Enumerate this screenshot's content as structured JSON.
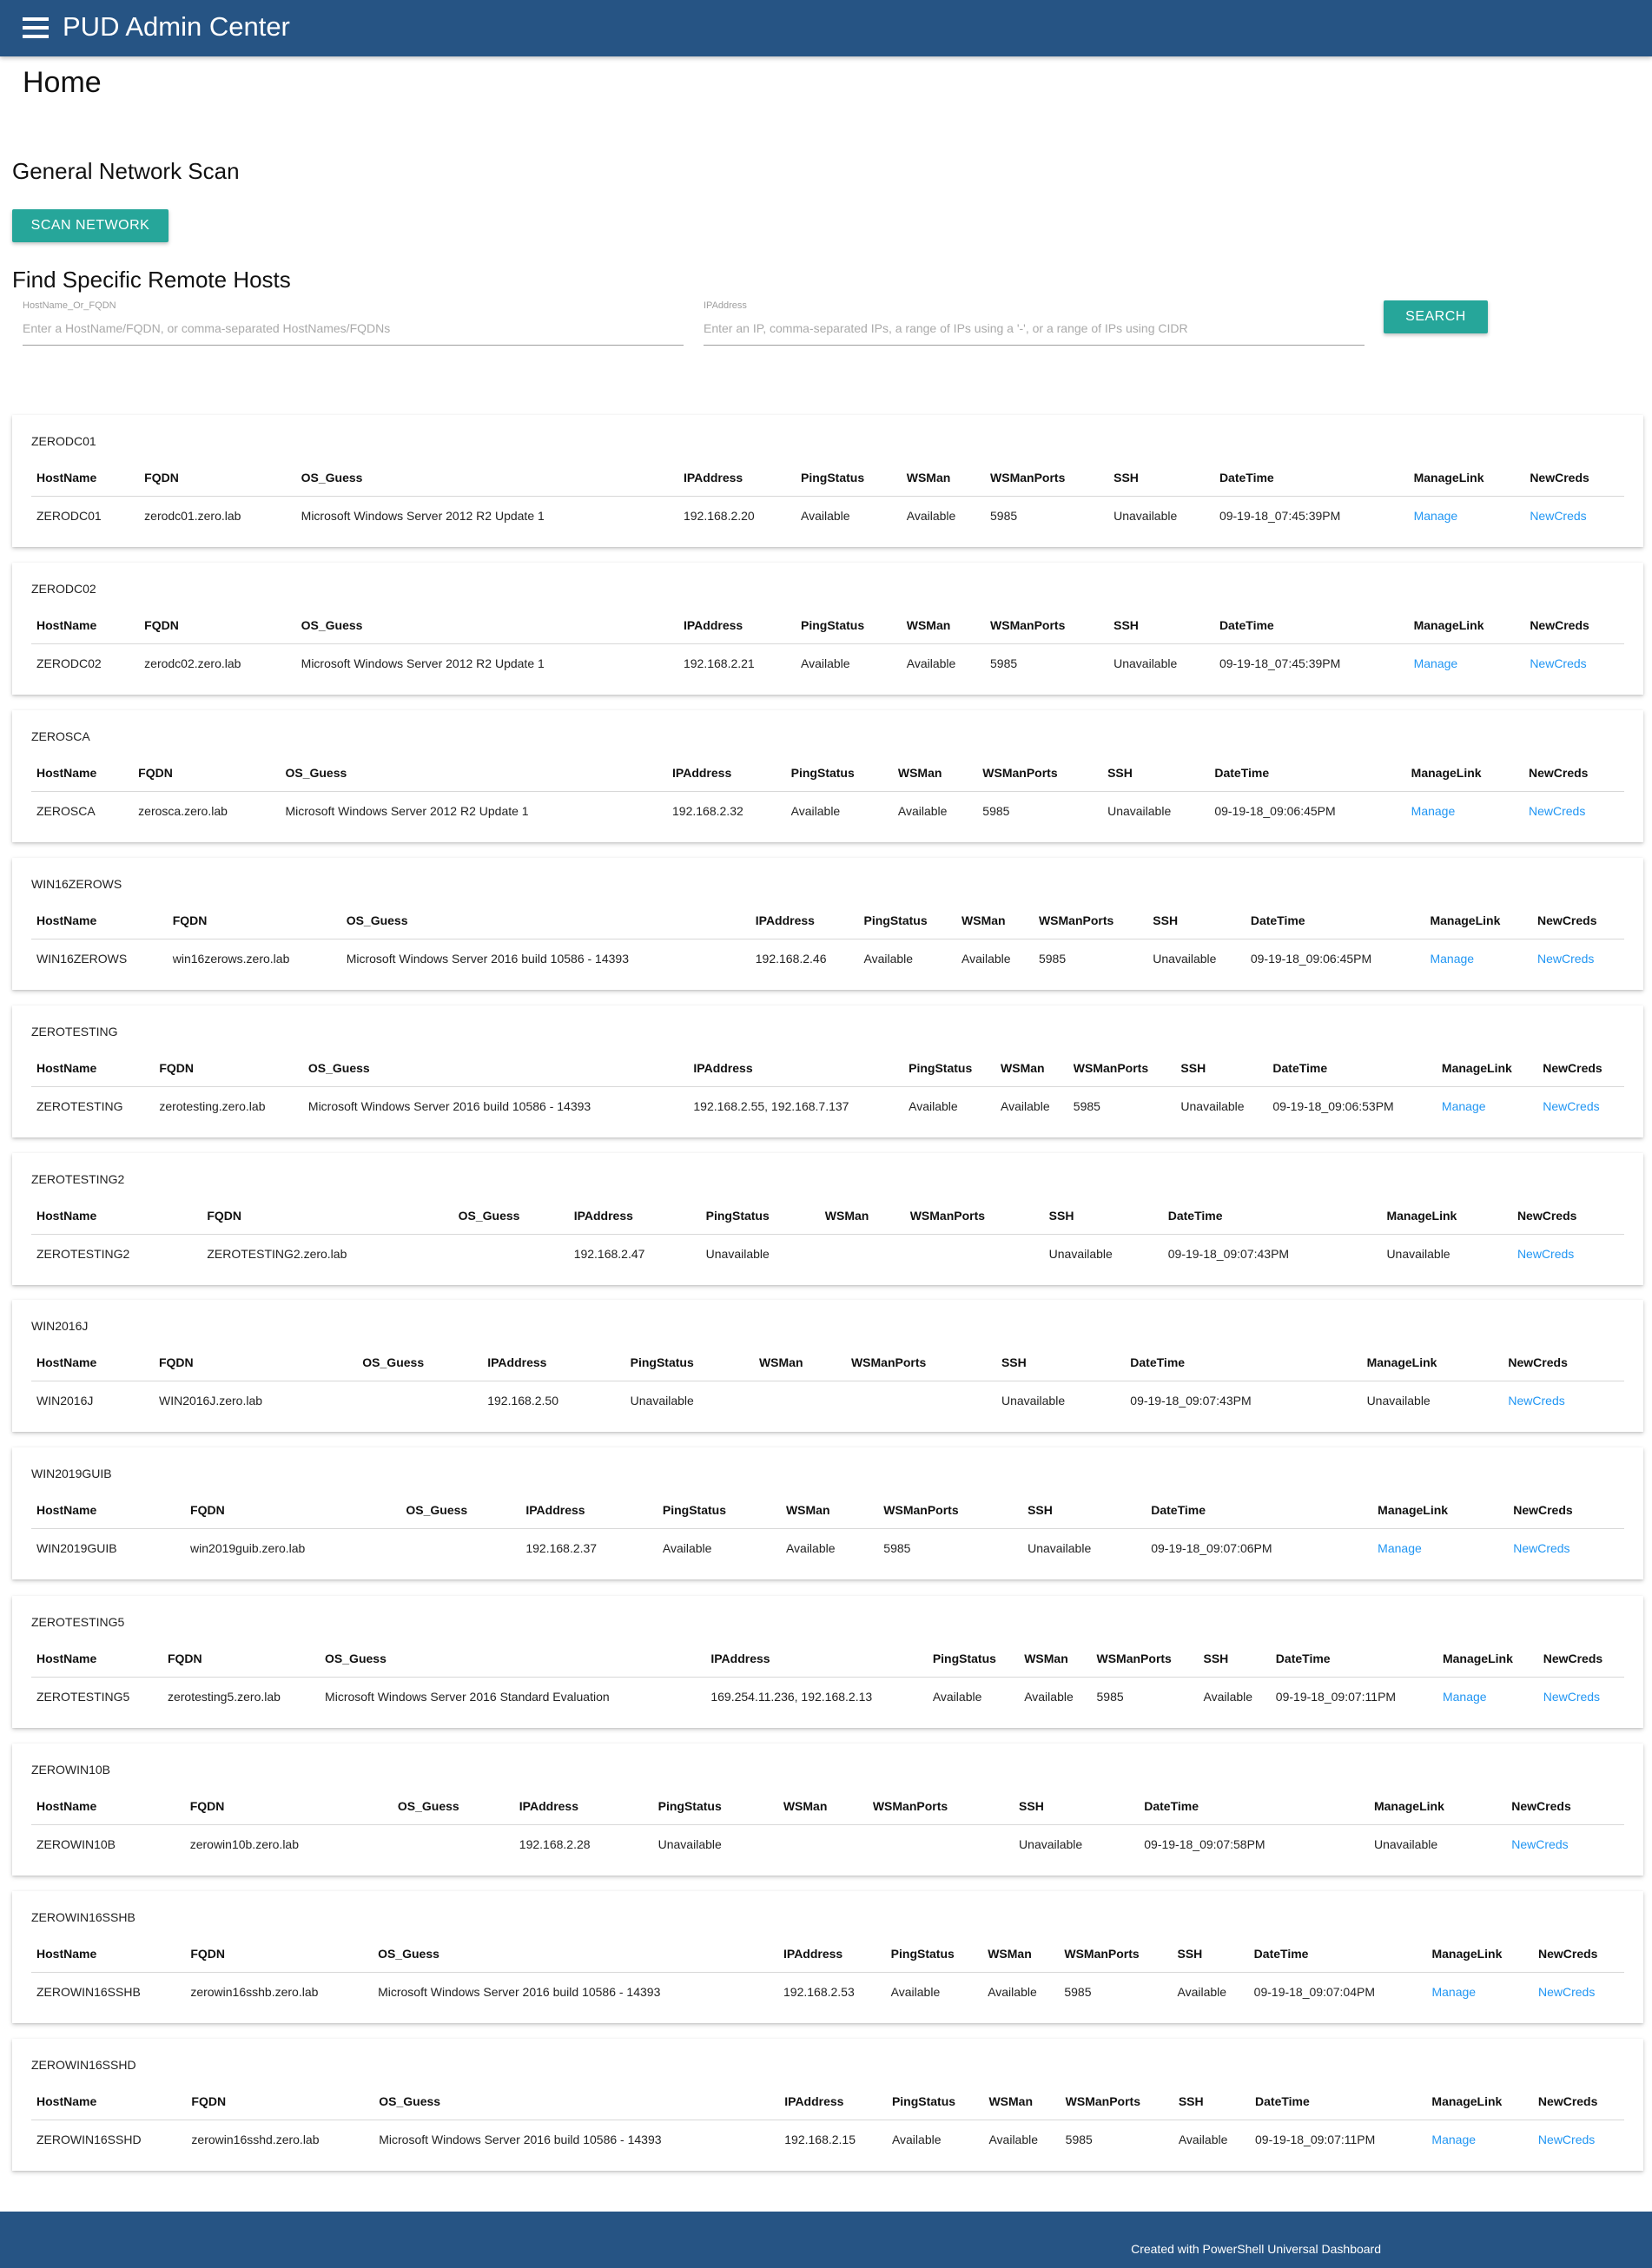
{
  "header": {
    "title": "PUD Admin Center"
  },
  "page_title": "Home",
  "scan": {
    "title": "General Network Scan",
    "button": "SCAN NETWORK"
  },
  "find": {
    "title": "Find Specific Remote Hosts",
    "hostname_label": "HostName_Or_FQDN",
    "hostname_placeholder": "Enter a HostName/FQDN, or comma-separated HostNames/FQDNs",
    "ip_label": "IPAddress",
    "ip_placeholder": "Enter an IP, comma-separated IPs, a range of IPs using a '-', or a range of IPs using CIDR",
    "search_button": "SEARCH"
  },
  "columns": [
    "HostName",
    "FQDN",
    "OS_Guess",
    "IPAddress",
    "PingStatus",
    "WSMan",
    "WSManPorts",
    "SSH",
    "DateTime",
    "ManageLink",
    "NewCreds"
  ],
  "hosts": [
    {
      "title": "ZERODC01",
      "HostName": "ZERODC01",
      "FQDN": "zerodc01.zero.lab",
      "OS_Guess": "Microsoft Windows Server 2012 R2 Update 1",
      "IPAddress": "192.168.2.20",
      "PingStatus": "Available",
      "WSMan": "Available",
      "WSManPorts": "5985",
      "SSH": "Unavailable",
      "DateTime": "09-19-18_07:45:39PM",
      "ManageLink": "Manage",
      "NewCreds": "NewCreds"
    },
    {
      "title": "ZERODC02",
      "HostName": "ZERODC02",
      "FQDN": "zerodc02.zero.lab",
      "OS_Guess": "Microsoft Windows Server 2012 R2 Update 1",
      "IPAddress": "192.168.2.21",
      "PingStatus": "Available",
      "WSMan": "Available",
      "WSManPorts": "5985",
      "SSH": "Unavailable",
      "DateTime": "09-19-18_07:45:39PM",
      "ManageLink": "Manage",
      "NewCreds": "NewCreds"
    },
    {
      "title": "ZEROSCA",
      "HostName": "ZEROSCA",
      "FQDN": "zerosca.zero.lab",
      "OS_Guess": "Microsoft Windows Server 2012 R2 Update 1",
      "IPAddress": "192.168.2.32",
      "PingStatus": "Available",
      "WSMan": "Available",
      "WSManPorts": "5985",
      "SSH": "Unavailable",
      "DateTime": "09-19-18_09:06:45PM",
      "ManageLink": "Manage",
      "NewCreds": "NewCreds"
    },
    {
      "title": "WIN16ZEROWS",
      "HostName": "WIN16ZEROWS",
      "FQDN": "win16zerows.zero.lab",
      "OS_Guess": "Microsoft Windows Server 2016 build 10586 - 14393",
      "IPAddress": "192.168.2.46",
      "PingStatus": "Available",
      "WSMan": "Available",
      "WSManPorts": "5985",
      "SSH": "Unavailable",
      "DateTime": "09-19-18_09:06:45PM",
      "ManageLink": "Manage",
      "NewCreds": "NewCreds"
    },
    {
      "title": "ZEROTESTING",
      "HostName": "ZEROTESTING",
      "FQDN": "zerotesting.zero.lab",
      "OS_Guess": "Microsoft Windows Server 2016 build 10586 - 14393",
      "IPAddress": "192.168.2.55, 192.168.7.137",
      "PingStatus": "Available",
      "WSMan": "Available",
      "WSManPorts": "5985",
      "SSH": "Unavailable",
      "DateTime": "09-19-18_09:06:53PM",
      "ManageLink": "Manage",
      "NewCreds": "NewCreds"
    },
    {
      "title": "ZEROTESTING2",
      "HostName": "ZEROTESTING2",
      "FQDN": "ZEROTESTING2.zero.lab",
      "OS_Guess": "",
      "IPAddress": "192.168.2.47",
      "PingStatus": "Unavailable",
      "WSMan": "",
      "WSManPorts": "",
      "SSH": "Unavailable",
      "DateTime": "09-19-18_09:07:43PM",
      "ManageLink": "Unavailable",
      "NewCreds": "NewCreds"
    },
    {
      "title": "WIN2016J",
      "HostName": "WIN2016J",
      "FQDN": "WIN2016J.zero.lab",
      "OS_Guess": "",
      "IPAddress": "192.168.2.50",
      "PingStatus": "Unavailable",
      "WSMan": "",
      "WSManPorts": "",
      "SSH": "Unavailable",
      "DateTime": "09-19-18_09:07:43PM",
      "ManageLink": "Unavailable",
      "NewCreds": "NewCreds"
    },
    {
      "title": "WIN2019GUIB",
      "HostName": "WIN2019GUIB",
      "FQDN": "win2019guib.zero.lab",
      "OS_Guess": "",
      "IPAddress": "192.168.2.37",
      "PingStatus": "Available",
      "WSMan": "Available",
      "WSManPorts": "5985",
      "SSH": "Unavailable",
      "DateTime": "09-19-18_09:07:06PM",
      "ManageLink": "Manage",
      "NewCreds": "NewCreds"
    },
    {
      "title": "ZEROTESTING5",
      "HostName": "ZEROTESTING5",
      "FQDN": "zerotesting5.zero.lab",
      "OS_Guess": "Microsoft Windows Server 2016 Standard Evaluation",
      "IPAddress": "169.254.11.236, 192.168.2.13",
      "PingStatus": "Available",
      "WSMan": "Available",
      "WSManPorts": "5985",
      "SSH": "Available",
      "DateTime": "09-19-18_09:07:11PM",
      "ManageLink": "Manage",
      "NewCreds": "NewCreds"
    },
    {
      "title": "ZEROWIN10B",
      "HostName": "ZEROWIN10B",
      "FQDN": "zerowin10b.zero.lab",
      "OS_Guess": "",
      "IPAddress": "192.168.2.28",
      "PingStatus": "Unavailable",
      "WSMan": "",
      "WSManPorts": "",
      "SSH": "Unavailable",
      "DateTime": "09-19-18_09:07:58PM",
      "ManageLink": "Unavailable",
      "NewCreds": "NewCreds"
    },
    {
      "title": "ZEROWIN16SSHB",
      "HostName": "ZEROWIN16SSHB",
      "FQDN": "zerowin16sshb.zero.lab",
      "OS_Guess": "Microsoft Windows Server 2016 build 10586 - 14393",
      "IPAddress": "192.168.2.53",
      "PingStatus": "Available",
      "WSMan": "Available",
      "WSManPorts": "5985",
      "SSH": "Available",
      "DateTime": "09-19-18_09:07:04PM",
      "ManageLink": "Manage",
      "NewCreds": "NewCreds"
    },
    {
      "title": "ZEROWIN16SSHD",
      "HostName": "ZEROWIN16SSHD",
      "FQDN": "zerowin16sshd.zero.lab",
      "OS_Guess": "Microsoft Windows Server 2016 build 10586 - 14393",
      "IPAddress": "192.168.2.15",
      "PingStatus": "Available",
      "WSMan": "Available",
      "WSManPorts": "5985",
      "SSH": "Available",
      "DateTime": "09-19-18_09:07:11PM",
      "ManageLink": "Manage",
      "NewCreds": "NewCreds"
    }
  ],
  "footer": {
    "text": "Created with PowerShell Universal Dashboard"
  },
  "colors": {
    "header_bg": "#265484",
    "button_bg": "#26a69a",
    "link": "#2196f3"
  }
}
